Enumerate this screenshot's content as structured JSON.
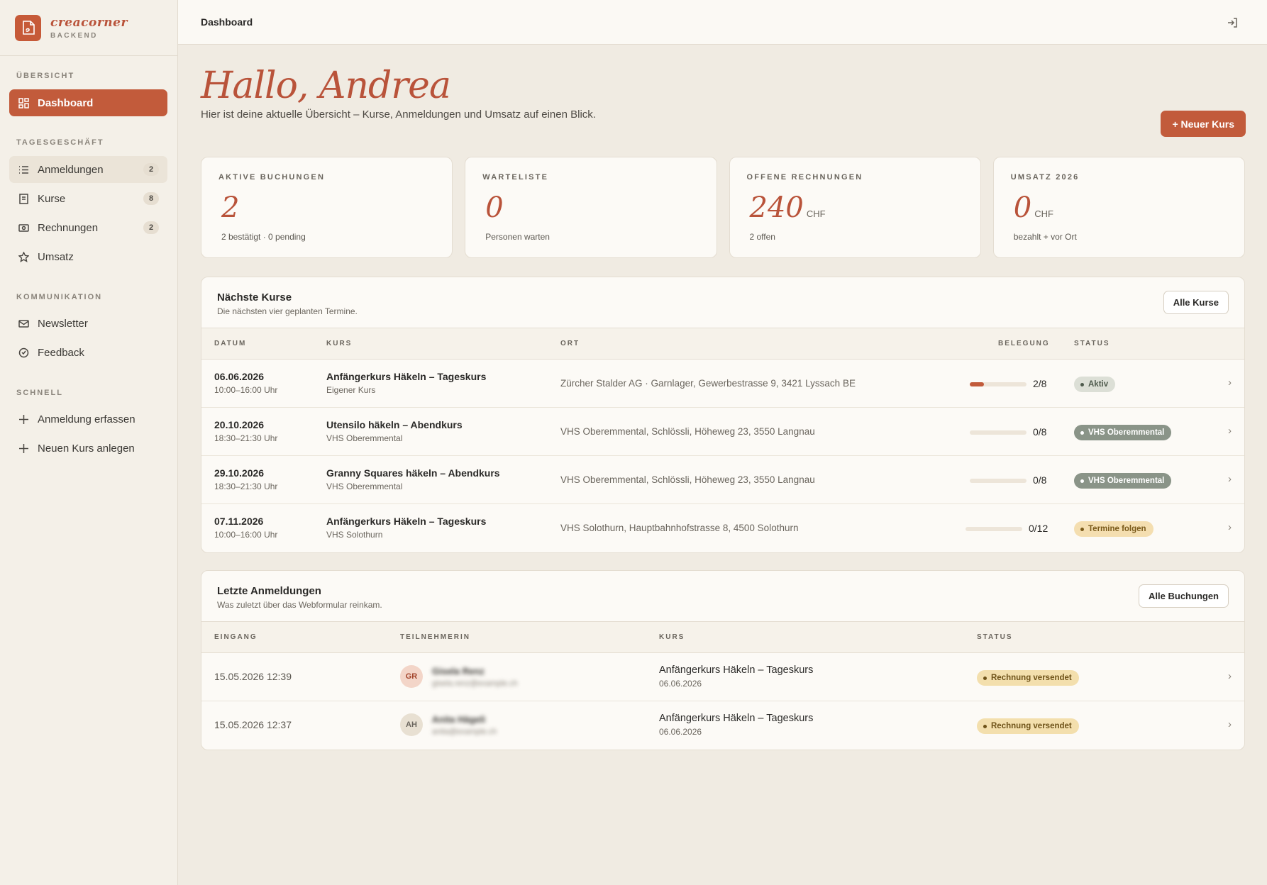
{
  "brand": {
    "name": "creacorner",
    "sub": "BACKEND"
  },
  "topbar": {
    "title": "Dashboard"
  },
  "sidebar": {
    "sections": [
      {
        "label": "ÜBERSICHT"
      },
      {
        "label": "TAGESGESCHÄFT"
      },
      {
        "label": "KOMMUNIKATION"
      },
      {
        "label": "SCHNELL"
      }
    ],
    "items": [
      {
        "label": "Dashboard",
        "icon": "grid-icon"
      },
      {
        "label": "Anmeldungen",
        "icon": "list-icon",
        "badge": "2"
      },
      {
        "label": "Kurse",
        "icon": "document-icon",
        "badge": "8"
      },
      {
        "label": "Rechnungen",
        "icon": "banknote-icon",
        "badge": "2"
      },
      {
        "label": "Umsatz",
        "icon": "star-icon"
      },
      {
        "label": "Newsletter",
        "icon": "mail-icon"
      },
      {
        "label": "Feedback",
        "icon": "heart-badge-icon"
      },
      {
        "label": "Anmeldung erfassen",
        "icon": "plus-icon"
      },
      {
        "label": "Neuen Kurs anlegen",
        "icon": "plus-icon"
      }
    ]
  },
  "header": {
    "greeting": "Hallo, Andrea",
    "intro": "Hier ist deine aktuelle Übersicht – Kurse, Anmeldungen und Umsatz auf einen Blick.",
    "new_course_label": "+ Neuer Kurs"
  },
  "kpis": [
    {
      "label": "AKTIVE BUCHUNGEN",
      "value": "2",
      "unit": "",
      "sub": "2 bestätigt · 0 pending"
    },
    {
      "label": "WARTELISTE",
      "value": "0",
      "unit": "",
      "sub": "Personen warten"
    },
    {
      "label": "OFFENE RECHNUNGEN",
      "value": "240",
      "unit": "CHF",
      "sub": "2 offen"
    },
    {
      "label": "UMSATZ 2026",
      "value": "0",
      "unit": "CHF",
      "sub": "bezahlt + vor Ort"
    }
  ],
  "courses_panel": {
    "title": "Nächste Kurse",
    "subtitle": "Die nächsten vier geplanten Termine.",
    "button": "Alle Kurse",
    "columns": [
      "DATUM",
      "KURS",
      "ORT",
      "BELEGUNG",
      "STATUS"
    ],
    "rows": [
      {
        "date": "06.06.2026",
        "time": "10:00–16:00 Uhr",
        "course": "Anfängerkurs Häkeln – Tageskurs",
        "org": "Eigener Kurs",
        "ort": "Zürcher Stalder AG · Garnlager, Gewerbestrasse 9, 3421 Lyssach BE",
        "occupancy": "2/8",
        "fill": 0.25,
        "status": "Aktiv",
        "status_kind": "aktiv"
      },
      {
        "date": "20.10.2026",
        "time": "18:30–21:30 Uhr",
        "course": "Utensilo häkeln – Abendkurs",
        "org": "VHS Oberemmental",
        "ort": "VHS Oberemmental, Schlössli, Höheweg 23, 3550 Langnau",
        "occupancy": "0/8",
        "fill": 0,
        "status": "VHS Oberemmental",
        "status_kind": "vhs"
      },
      {
        "date": "29.10.2026",
        "time": "18:30–21:30 Uhr",
        "course": "Granny Squares häkeln – Abendkurs",
        "org": "VHS Oberemmental",
        "ort": "VHS Oberemmental, Schlössli, Höheweg 23, 3550 Langnau",
        "occupancy": "0/8",
        "fill": 0,
        "status": "VHS Oberemmental",
        "status_kind": "vhs"
      },
      {
        "date": "07.11.2026",
        "time": "10:00–16:00 Uhr",
        "course": "Anfängerkurs Häkeln – Tageskurs",
        "org": "VHS Solothurn",
        "ort": "VHS Solothurn, Hauptbahnhofstrasse 8, 4500 Solothurn",
        "occupancy": "0/12",
        "fill": 0,
        "status": "Termine folgen",
        "status_kind": "folgen"
      }
    ]
  },
  "registrations_panel": {
    "title": "Letzte Anmeldungen",
    "subtitle": "Was zuletzt über das Webformular reinkam.",
    "button": "Alle Buchungen",
    "columns": [
      "EINGANG",
      "TEILNEHMERIN",
      "KURS",
      "STATUS"
    ],
    "rows": [
      {
        "received": "15.05.2026 12:39",
        "initials": "GR",
        "avatar_bg": "#f3d5c8",
        "avatar_fg": "#a3452c",
        "name": "Gisela Renz",
        "email": "gisela.renz@example.ch",
        "course": "Anfängerkurs Häkeln – Tageskurs",
        "course_date": "06.06.2026",
        "status": "Rechnung versendet"
      },
      {
        "received": "15.05.2026 12:37",
        "initials": "AH",
        "avatar_bg": "#e8e0d2",
        "avatar_fg": "#6a655d",
        "name": "Anita Hägeli",
        "email": "anita@example.ch",
        "course": "Anfängerkurs Häkeln – Tageskurs",
        "course_date": "06.06.2026",
        "status": "Rechnung versendet"
      }
    ]
  },
  "colors": {
    "accent": "#c25b3b",
    "background": "#f0ebe2",
    "panel": "#fcfaf6"
  }
}
